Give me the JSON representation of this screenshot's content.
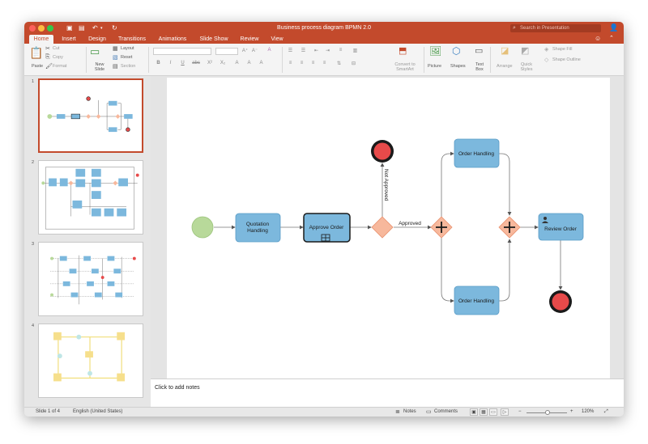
{
  "window": {
    "title": "Business process diagram BPMN 2.0",
    "search_placeholder": "Search in Presentation"
  },
  "tabs": [
    "Home",
    "Insert",
    "Design",
    "Transitions",
    "Animations",
    "Slide Show",
    "Review",
    "View"
  ],
  "ribbon": {
    "paste": "Paste",
    "cut": "Cut",
    "copy": "Copy",
    "format": "Format",
    "new_slide": "New Slide",
    "layout": "Layout",
    "reset": "Reset",
    "section": "Section",
    "bold": "B",
    "italic": "I",
    "underline": "U",
    "strike": "abc",
    "superscript": "X²",
    "subscript": "X₂",
    "convert_smartart": "Convert to SmartArt",
    "picture": "Picture",
    "shapes": "Shapes",
    "text_box": "Text Box",
    "arrange": "Arrange",
    "quick_styles": "Quick Styles",
    "shape_fill": "Shape Fill",
    "shape_outline": "Shape Outline"
  },
  "thumbnails": {
    "numbers": [
      "1",
      "2",
      "3",
      "4"
    ]
  },
  "diagram": {
    "task_quotation": "Quotation Handling",
    "task_approve": "Approve Order",
    "task_order_top": "Order Handling",
    "task_order_bottom": "Order Handling",
    "task_review": "Review Order",
    "label_not_approved": "Not Approved",
    "label_approved": "Approved",
    "colors": {
      "task": "#7cb8dd",
      "task_border": "#5a9cc6",
      "start": "#b8d99a",
      "end": "#e84a4a",
      "gateway": "#f7b89c",
      "gateway_border": "#e9916e"
    }
  },
  "notes": {
    "placeholder": "Click to add notes"
  },
  "status": {
    "slide_indicator": "Slide 1 of 4",
    "language": "English (United States)",
    "notes": "Notes",
    "comments": "Comments",
    "zoom": "120%"
  }
}
